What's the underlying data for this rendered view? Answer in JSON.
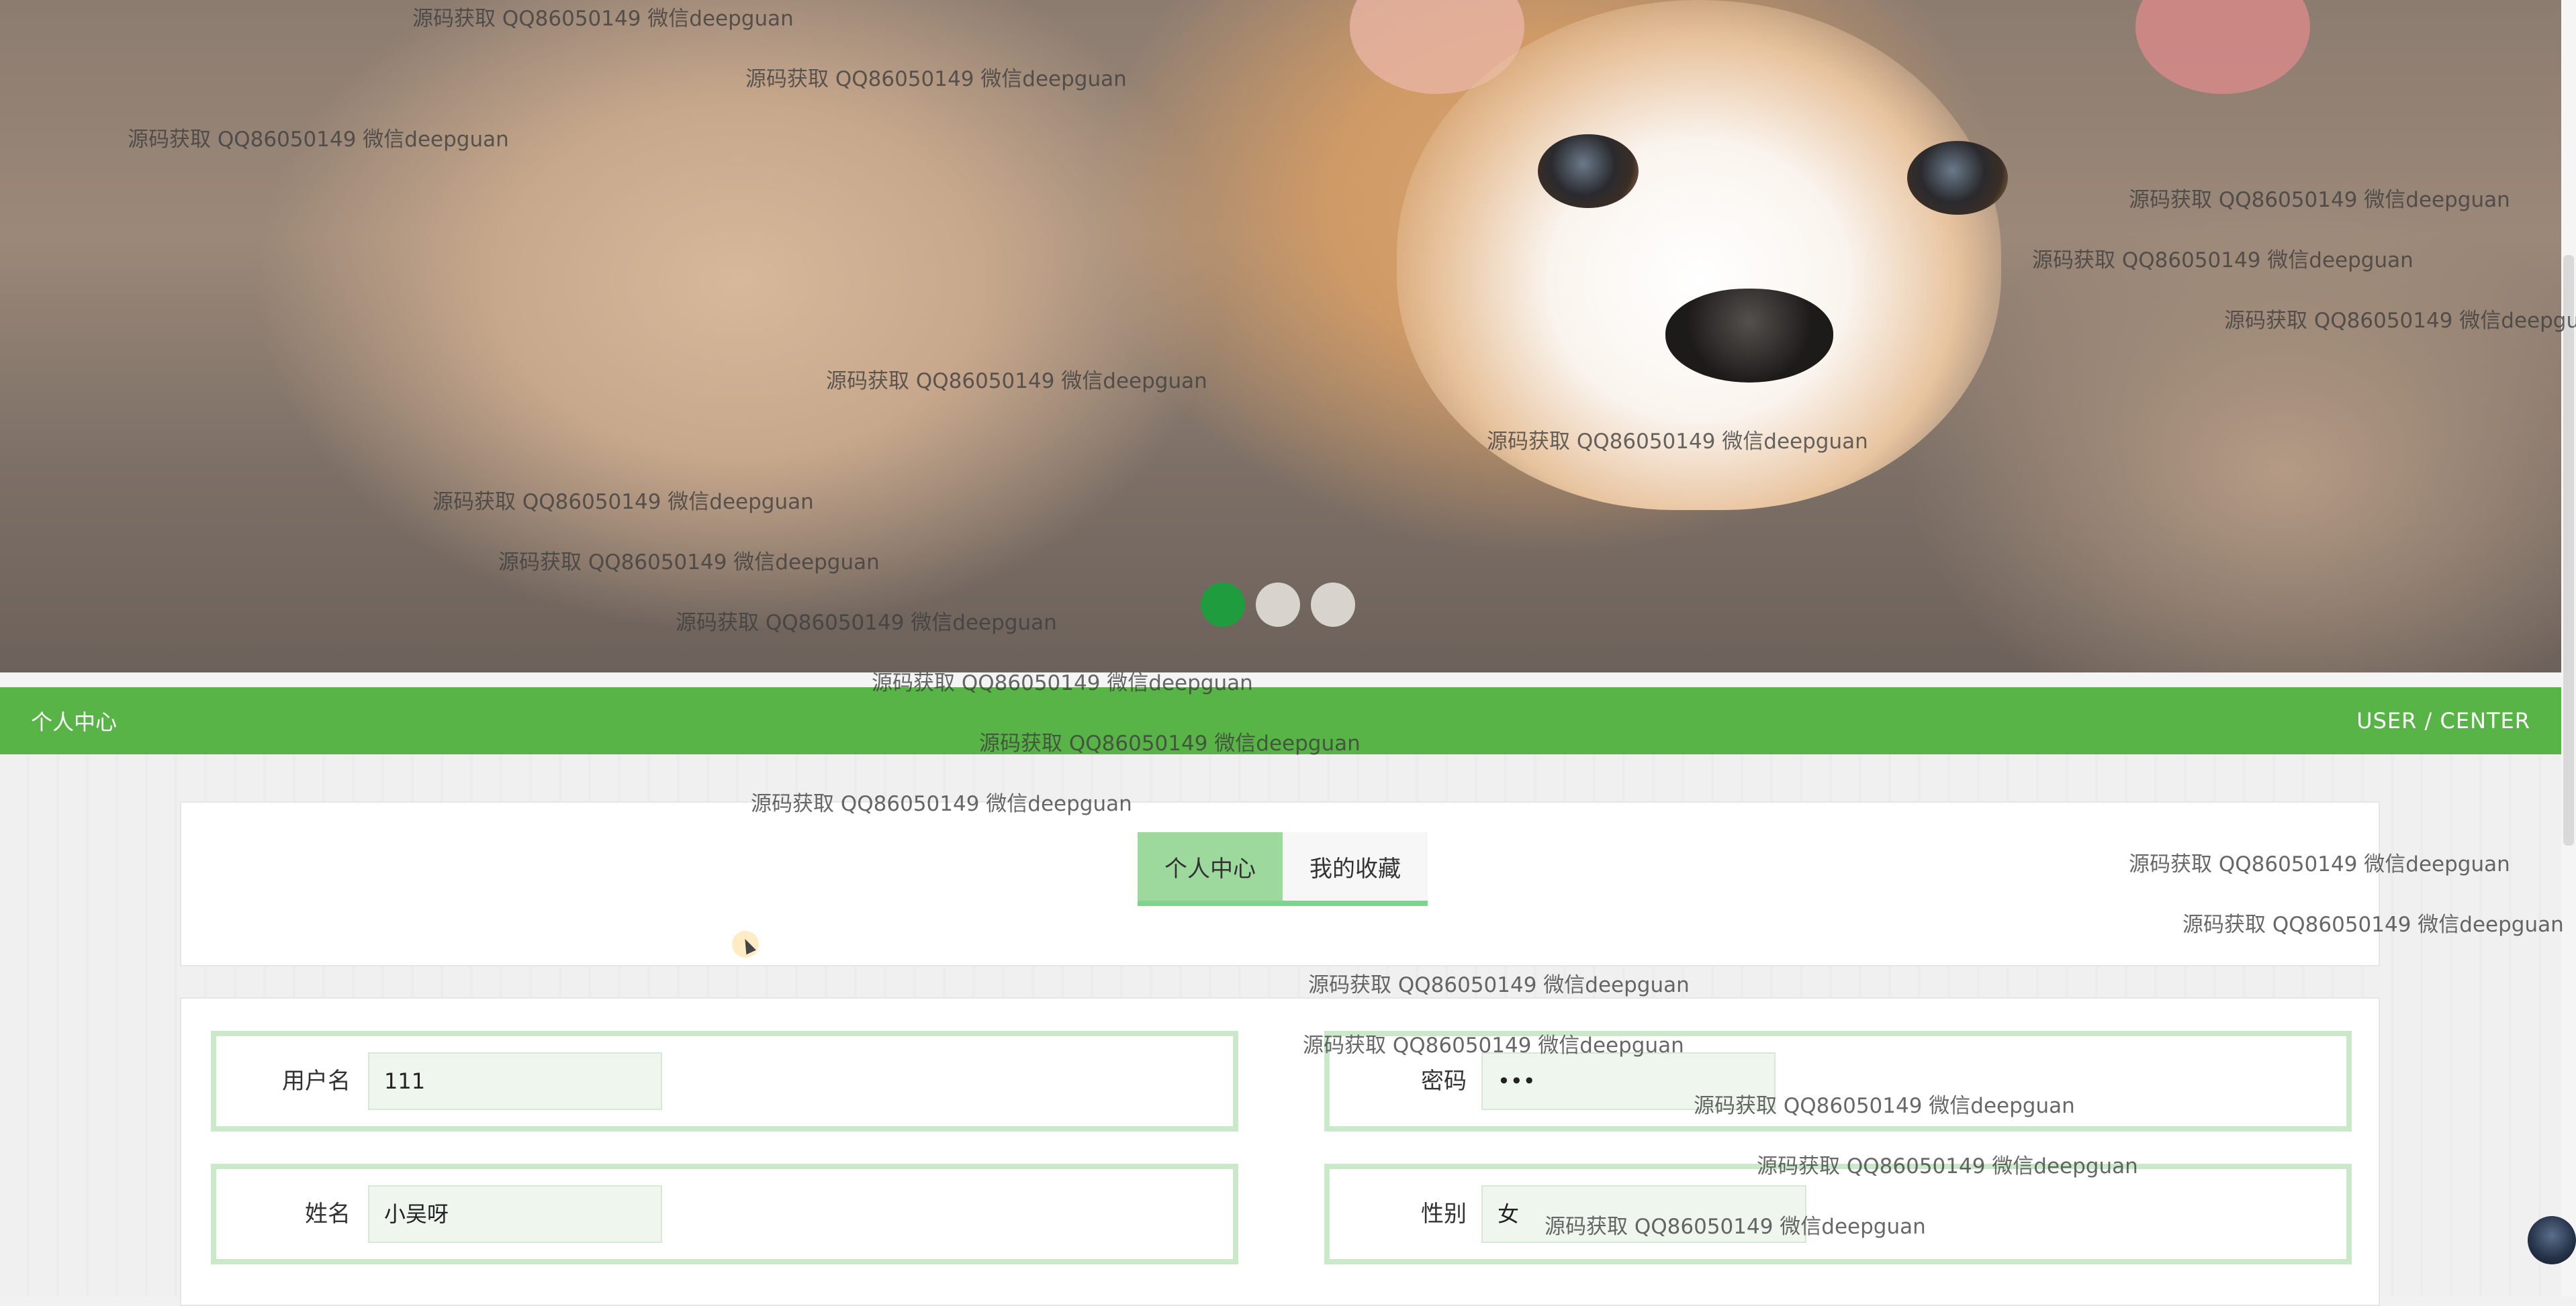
{
  "banner": {
    "active_slide": 1,
    "slide_count": 3
  },
  "header": {
    "title": "个人中心",
    "subtitle": "USER / CENTER"
  },
  "tabs": [
    {
      "label": "个人中心",
      "active": true
    },
    {
      "label": "我的收藏",
      "active": false
    }
  ],
  "form": {
    "username_label": "用户名",
    "username_value": "111",
    "password_label": "密码",
    "password_value": "•••",
    "name_label": "姓名",
    "name_value": "小吴呀",
    "gender_label": "性别",
    "gender_value": "女"
  },
  "watermarks": [
    "源码获取 QQ86050149 微信deepguan",
    "源码获取 QQ86050149 微信deepguan",
    "源码获取 QQ86050149 微信deepguan",
    "源码获取 QQ86050149 微信deepguan",
    "源码获取 QQ86050149 微信deepguan",
    "源码获取 QQ86050149 微信deepguan",
    "源码获取 QQ86050149 微信deepguan",
    "源码获取 QQ86050149 微信deepguan",
    "源码获取 QQ86050149 微信deepguan",
    "源码获取 QQ86050149 微信deepguan",
    "源码获取 QQ86050149 微信deepguan",
    "源码获取 QQ86050149 微信deepguan",
    "源码获取 QQ86050149 微信deepguan",
    "源码获取 QQ86050149 微信deepguan",
    "源码获取 QQ86050149 微信deepguan",
    "源码获取 QQ86050149 微信deepguan",
    "源码获取 QQ86050149 微信deepguan",
    "源码获取 QQ86050149 微信deepguan",
    "源码获取 QQ86050149 微信deepguan",
    "源码获取 QQ86050149 微信deepguan",
    "源码获取 QQ86050149 微信deepguan",
    "源码获取 QQ86050149 微信deepguan"
  ],
  "colors": {
    "header_green": "#58b446",
    "active_dot": "#1f9d3e",
    "tab_active": "#9dd99d",
    "field_border": "#c9e9c9"
  }
}
